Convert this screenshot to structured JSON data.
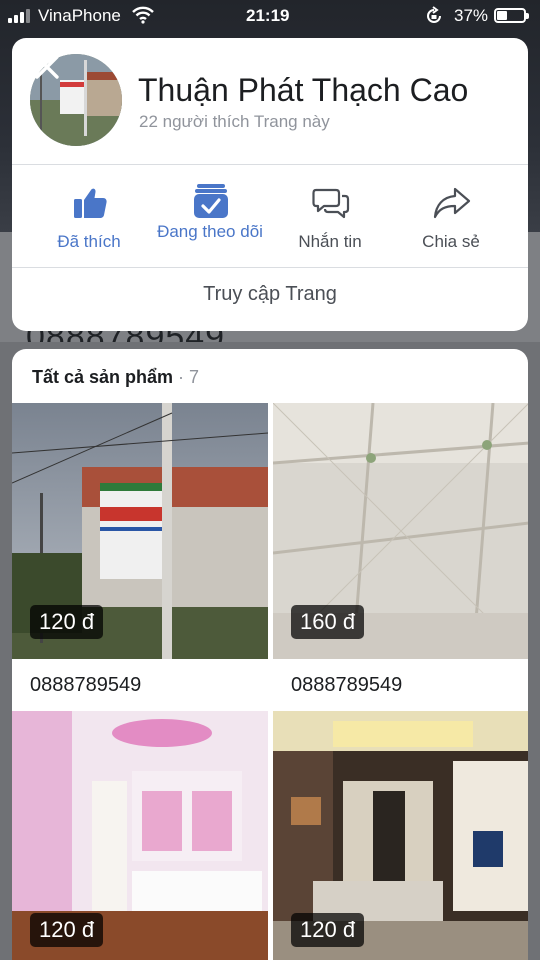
{
  "status_bar": {
    "carrier": "VinaPhone",
    "time": "21:19",
    "battery_percent_label": "37%",
    "battery_level": 0.37
  },
  "background": {
    "phone_text": "0888789549"
  },
  "page": {
    "close_icon": "close-icon",
    "name": "Thuận Phát Thạch Cao",
    "likes_text": "22 người thích Trang này",
    "actions": [
      {
        "label": "Đã thích",
        "icon": "thumbs-up-icon"
      },
      {
        "label": "Đang theo dõi",
        "icon": "following-icon"
      },
      {
        "label": "Nhắn tin",
        "icon": "message-icon"
      },
      {
        "label": "Chia sẻ",
        "icon": "share-icon"
      }
    ],
    "visit_label": "Truy cập Trang"
  },
  "products": {
    "title": "Tất cả sản phẩm",
    "separator": " · ",
    "count": "7",
    "items": [
      {
        "price": "120 đ",
        "caption": "0888789549"
      },
      {
        "price": "160 đ",
        "caption": "0888789549"
      },
      {
        "price": "120 đ"
      },
      {
        "price": "120 đ"
      }
    ]
  },
  "colors": {
    "accent": "#4a76c8",
    "text_primary": "#1c1e21",
    "text_secondary": "#90949c"
  }
}
